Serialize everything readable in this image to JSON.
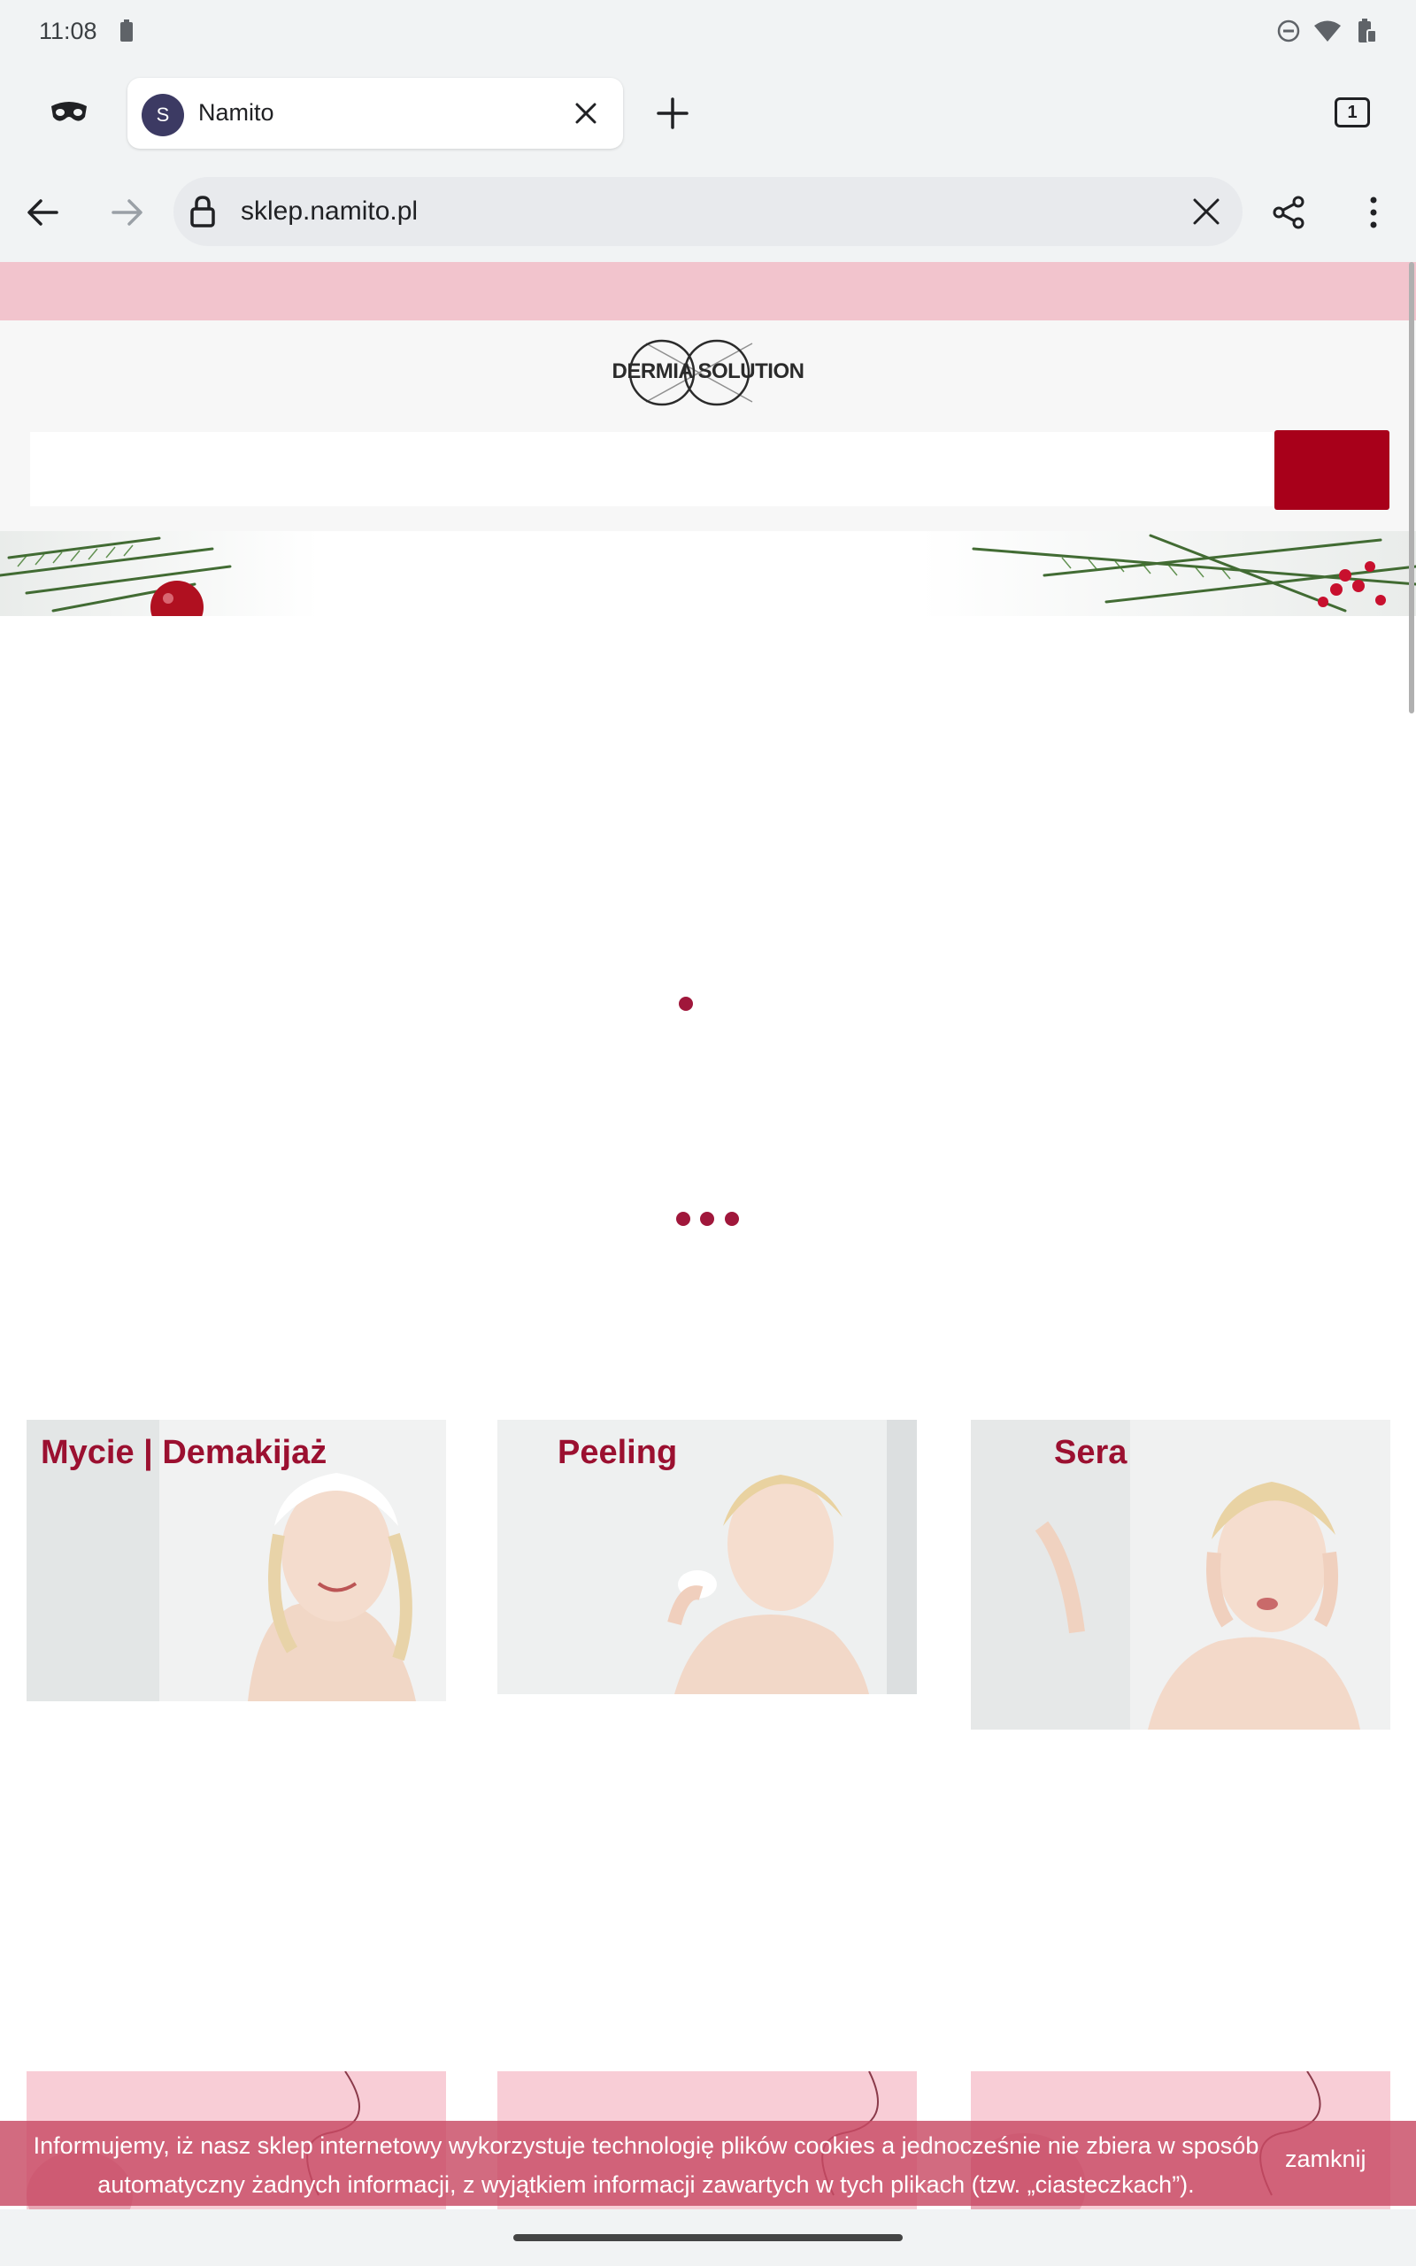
{
  "status_bar": {
    "time": "11:08"
  },
  "tab": {
    "favicon_letter": "S",
    "title": "Namito"
  },
  "tab_switcher": {
    "count": "1"
  },
  "omnibox": {
    "url": "sklep.namito.pl"
  },
  "brand": {
    "logo_text": "DERMIA SOLUTION"
  },
  "colors": {
    "accent": "#a8001a",
    "promo": "#f2c4cd",
    "category_title": "#9b1030",
    "cookie_bar": "#c84a64"
  },
  "categories": [
    {
      "title": "Mycie | Demakijaż"
    },
    {
      "title": "Peeling"
    },
    {
      "title": "Sera"
    }
  ],
  "cookie": {
    "text": "Informujemy, iż nasz sklep internetowy wykorzystuje technologię plików cookies a jednocześnie nie zbiera w sposób automatyczny żadnych informacji, z wyjątkiem informacji zawartych w tych plikach (tzw. „ciasteczkach”).",
    "close_label": "zamknij"
  },
  "icons": [
    "incognito-icon",
    "close-icon",
    "plus-icon",
    "back-arrow-icon",
    "forward-arrow-icon",
    "lock-icon",
    "share-icon",
    "more-vert-icon",
    "wifi-icon",
    "dnd-icon",
    "battery-icon"
  ]
}
